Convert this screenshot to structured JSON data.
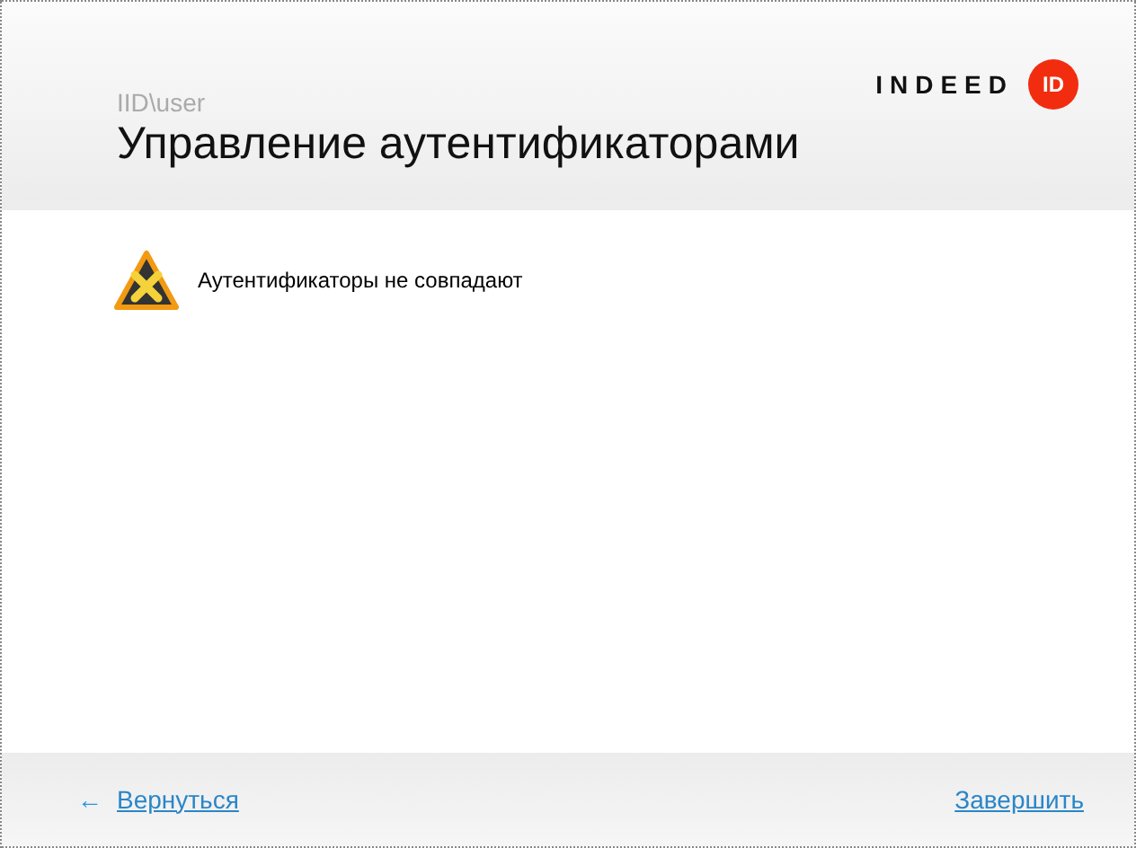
{
  "header": {
    "account": "IID\\user",
    "title": "Управление аутентификаторами",
    "logo": {
      "text": "INDEED",
      "badge": "ID"
    }
  },
  "messages": [
    {
      "kind": "error",
      "text": "Аутентификаторы не совпадают"
    }
  ],
  "footer": {
    "back": {
      "icon": "←",
      "label": "Вернуться"
    },
    "finish": "Завершить"
  }
}
